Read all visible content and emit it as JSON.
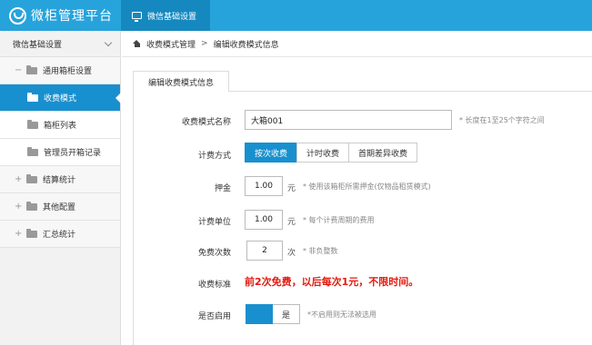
{
  "app": {
    "title": "微柜管理平台",
    "active_tab": "微信基础设置"
  },
  "sidebar": {
    "header": "微信基础设置",
    "items": [
      {
        "label": "通用箱柜设置",
        "toggle": "−"
      },
      {
        "label": "收费模式"
      },
      {
        "label": "箱柜列表"
      },
      {
        "label": "管理员开箱记录"
      },
      {
        "label": "结算统计",
        "toggle": "+"
      },
      {
        "label": "其他配置",
        "toggle": "+"
      },
      {
        "label": "汇总统计",
        "toggle": "+"
      }
    ]
  },
  "breadcrumb": {
    "parent": "收费模式管理",
    "separator": ">",
    "current": "编辑收费模式信息"
  },
  "panel": {
    "tab": "编辑收费模式信息"
  },
  "form": {
    "name": {
      "label": "收费模式名称",
      "value": "大箱001",
      "hint": "* 长度在1至25个字符之间"
    },
    "billing": {
      "label": "计费方式",
      "options": [
        "按次收费",
        "计时收费",
        "首期差异收费"
      ],
      "selected": "按次收费"
    },
    "deposit": {
      "label": "押金",
      "value": "1.00",
      "unit": "元",
      "hint": "* 使用该箱柜所需押金(仅物品租赁模式)"
    },
    "unit_price": {
      "label": "计费单位",
      "value": "1.00",
      "unit": "元",
      "hint": "* 每个计费周期的费用"
    },
    "free_times": {
      "label": "免费次数",
      "value": "2",
      "unit": "次",
      "hint": "* 非负整数"
    },
    "rule": {
      "label": "收费标准",
      "text": "前2次免费，以后每次1元，不限时间。"
    },
    "enabled": {
      "label": "是否启用",
      "value": "是",
      "hint": "*不启用则无法被选用"
    }
  },
  "colors": {
    "accent": "#27a3dc",
    "active": "#1890cf",
    "highlight": "#e4190e"
  }
}
